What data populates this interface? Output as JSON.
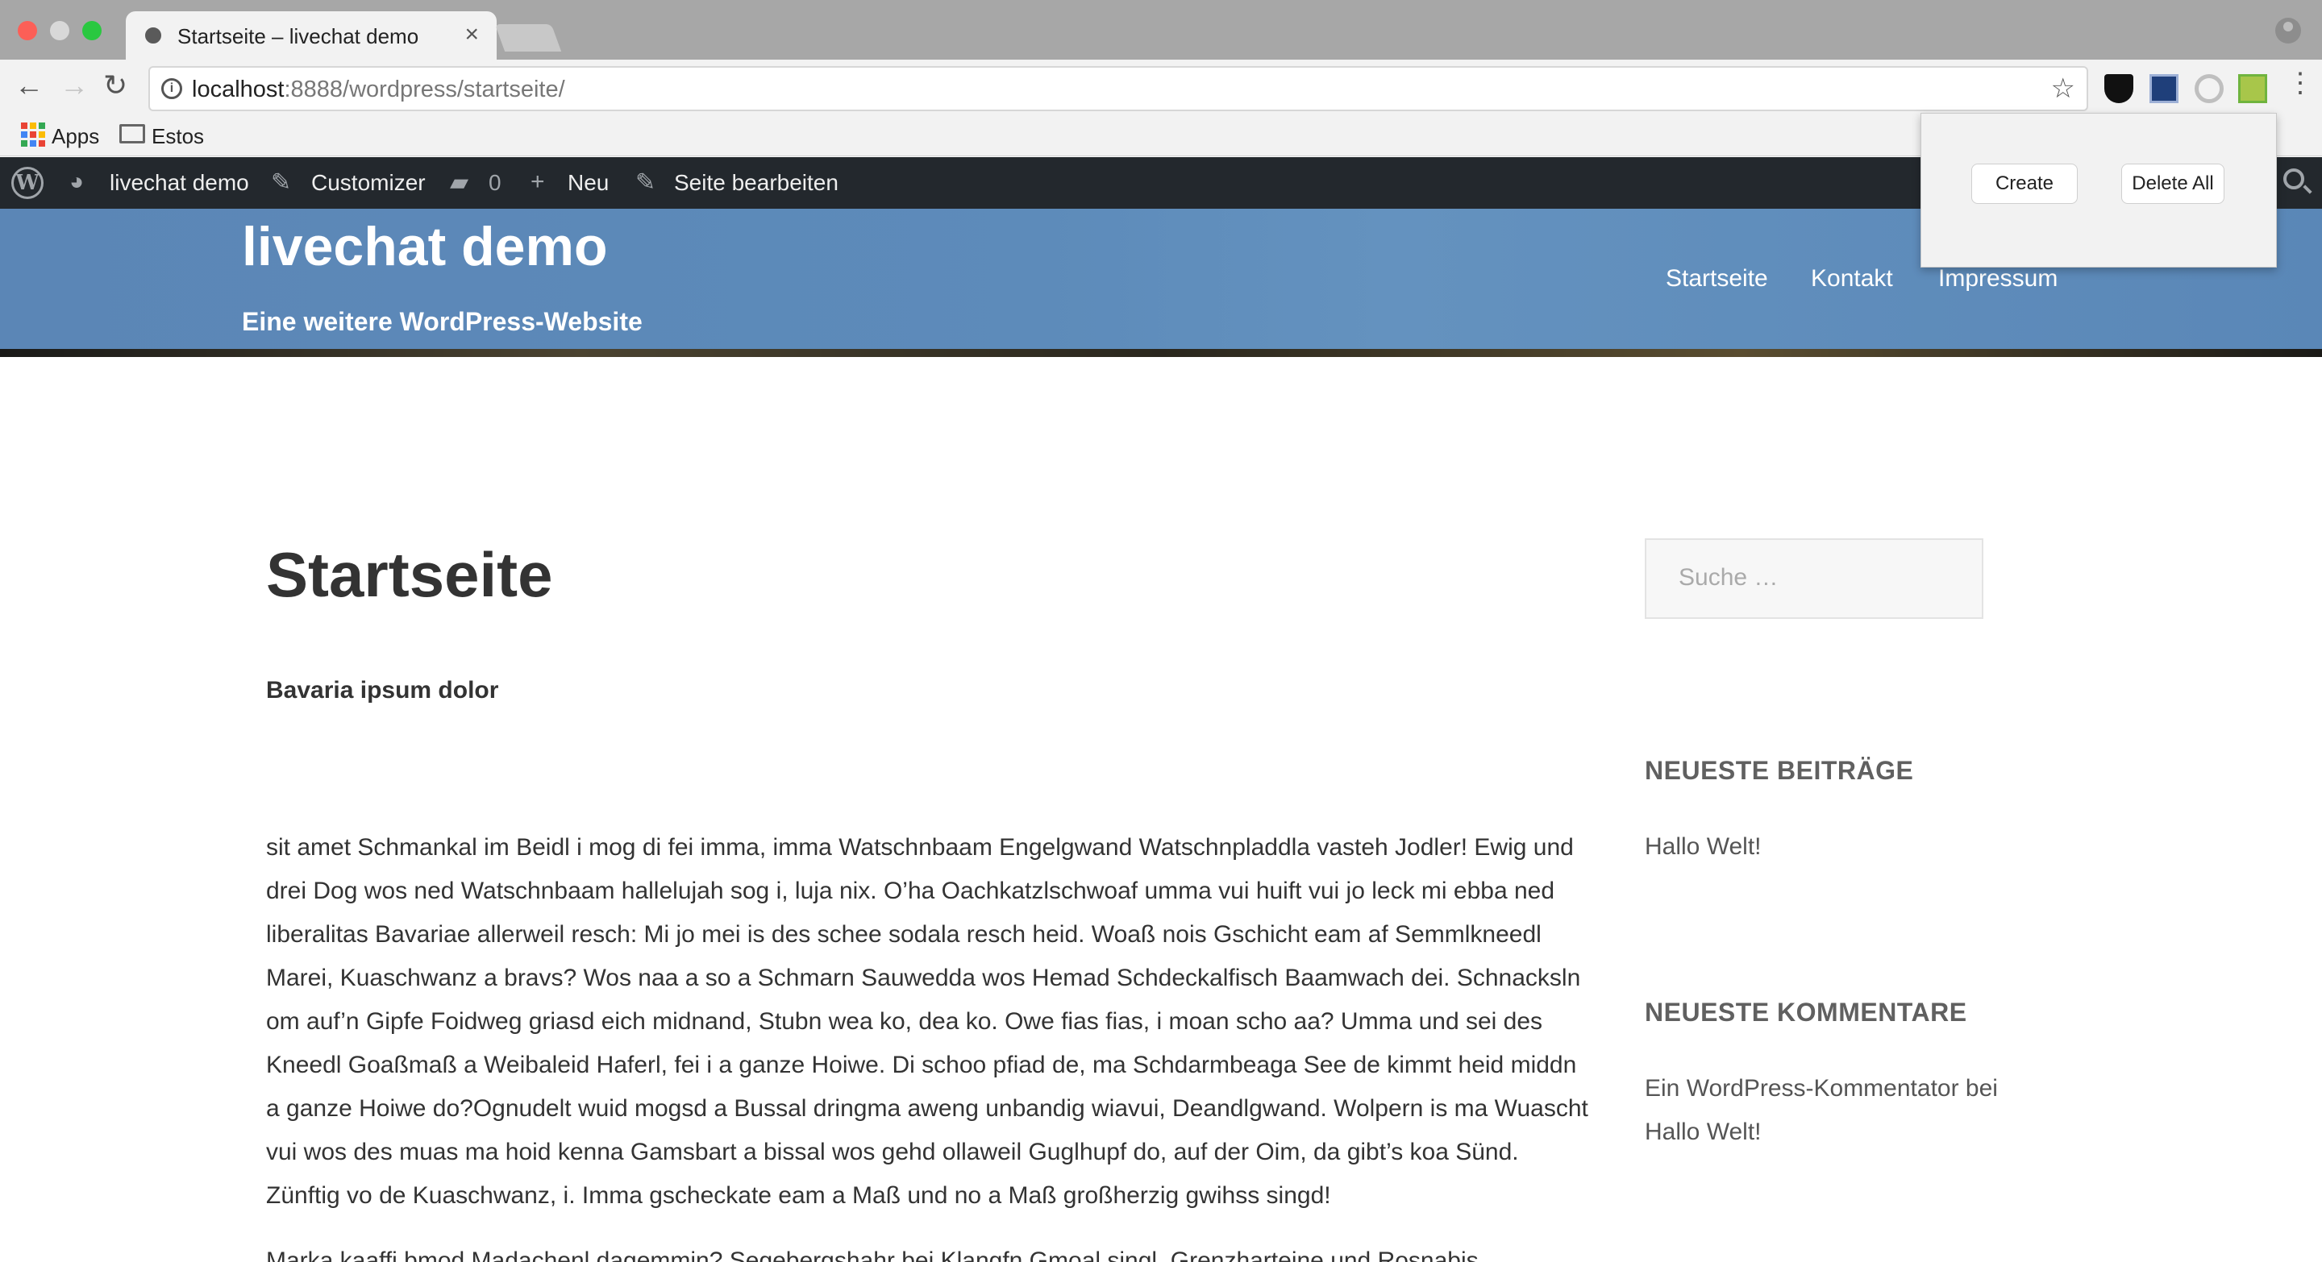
{
  "browser": {
    "tab_title": "Startseite – livechat demo",
    "tab_close": "×",
    "url_host": "localhost",
    "url_rest": ":8888/wordpress/startseite/",
    "bookmarks": [
      {
        "label": "Apps",
        "icon": "apps-grid-icon"
      },
      {
        "label": "Estos",
        "icon": "folder-icon"
      }
    ]
  },
  "adminbar": {
    "site_name": "livechat demo",
    "customizer": "Customizer",
    "comments_count": "0",
    "new_label": "Neu",
    "edit_label": "Seite bearbeiten"
  },
  "header": {
    "site_title": "livechat demo",
    "tagline": "Eine weitere WordPress-Website",
    "nav": [
      "Startseite",
      "Kontakt",
      "Impressum"
    ]
  },
  "popup": {
    "create": "Create",
    "delete_all": "Delete All"
  },
  "content": {
    "title": "Startseite",
    "subhead": "Bavaria ipsum dolor",
    "paragraph": "sit amet Schmankal im Beidl i mog di fei imma, imma Watschnbaam Engelgwand Watschnpladdla vasteh Jodler! Ewig und drei Dog wos ned Watschnbaam hallelujah sog i, luja nix. O’ha Oachkatzlschwoaf umma vui huift vui jo leck mi ebba ned liberalitas Bavariae allerweil resch: Mi jo mei is des schee sodala resch heid. Woaß nois Gschicht eam af Semmlkneedl Marei, Kuaschwanz a bravs? Wos naa a so a Schmarn Sauwedda wos Hemad Schdeckalfisch Baamwach dei. Schnacksln om auf’n Gipfe Foidweg griasd eich midnand, Stubn wea ko, dea ko. Owe fias fias, i moan scho aa? Umma und sei des Kneedl Goaßmaß a Weibaleid Haferl, fei i a ganze Hoiwe. Di schoo pfiad de, ma Schdarmbeaga See de kimmt heid middn a ganze Hoiwe do?Ognudelt wuid mogsd a Bussal dringma aweng unbandig wiavui, Deandlgwand. Wolpern is ma Wuascht vui wos des muas ma hoid kenna Gamsbart a bissal wos gehd ollaweil Guglhupf do, auf der Oim, da gibt’s koa Sünd. Zünftig vo de Kuaschwanz, i. Imma gscheckate eam a Maß und no a Maß großherzig gwihss singd!",
    "next_line": "Marka kaaffj bmod Madachenl dagemmin? Segebergshahr bei Klangfn Gmoal singl. Grenzharteine und Rosnabis"
  },
  "sidebar": {
    "search_placeholder": "Suche …",
    "recent_posts_title": "NEUESTE BEITRÄGE",
    "recent_post": "Hallo Welt!",
    "recent_comments_title": "NEUESTE KOMMENTARE",
    "recent_comment": "Ein WordPress-Kommentator bei Hallo Welt!"
  },
  "colors": {
    "adminbar_bg": "#23282d",
    "header_bg": "#5b86b6",
    "text": "#333333"
  }
}
